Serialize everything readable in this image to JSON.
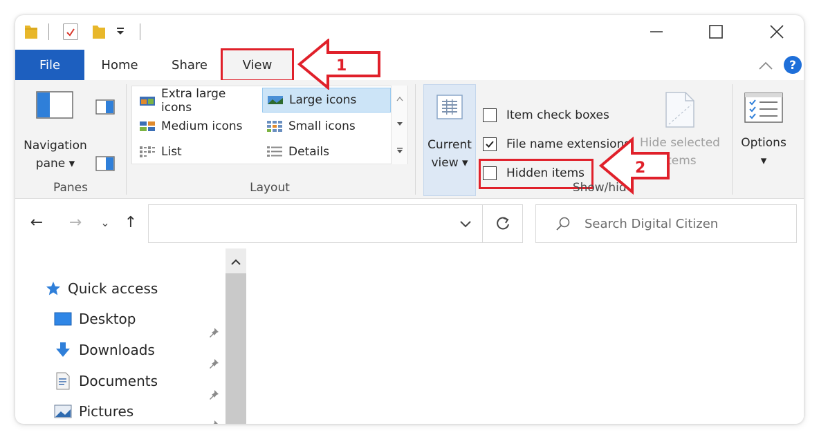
{
  "quick_access_toolbar": {
    "icons": [
      "folder-icon",
      "properties-icon",
      "new-folder-icon",
      "customize-dropdown-icon"
    ]
  },
  "window_controls": {
    "icons": [
      "minimize-icon",
      "maximize-icon",
      "close-icon"
    ]
  },
  "tabs": {
    "file": "File",
    "home": "Home",
    "share": "Share",
    "view": "View"
  },
  "ribbon": {
    "panes": {
      "navigation_pane": "Navigation",
      "navigation_pane_2": "pane ▾",
      "group_label": "Panes"
    },
    "layout": {
      "items": [
        "Extra large icons",
        "Large icons",
        "Medium icons",
        "Small icons",
        "List",
        "Details"
      ],
      "selected": "Large icons",
      "group_label": "Layout"
    },
    "current_view": {
      "line1": "Current",
      "line2": "view ▾"
    },
    "show_hide": {
      "item_check_boxes": "Item check boxes",
      "item_check_boxes_checked": false,
      "file_name_extensions": "File name extensions",
      "file_name_extensions_checked": true,
      "hidden_items": "Hidden items",
      "hidden_items_checked": false,
      "hide_selected_1": "Hide selected",
      "hide_selected_2": "items",
      "group_label": "Show/hide"
    },
    "options": {
      "label": "Options",
      "arrow": "▾"
    }
  },
  "address_bar": {
    "back_glyph": "←",
    "forward_glyph": "→",
    "recent_glyph": "⌄",
    "up_glyph": "↑",
    "dropdown_glyph": "⌄",
    "search_placeholder": "Search Digital Citizen"
  },
  "navigation": {
    "quick_access": "Quick access",
    "items": [
      "Desktop",
      "Downloads",
      "Documents",
      "Pictures"
    ]
  },
  "callouts": {
    "step1": "1",
    "step2": "2"
  },
  "colors": {
    "file_tab": "#1d5fbf",
    "highlight_red": "#e0202a",
    "selection_blue": "#cce4f7",
    "folder_yellow": "#e8b72a",
    "help_blue": "#1e6fd9"
  }
}
